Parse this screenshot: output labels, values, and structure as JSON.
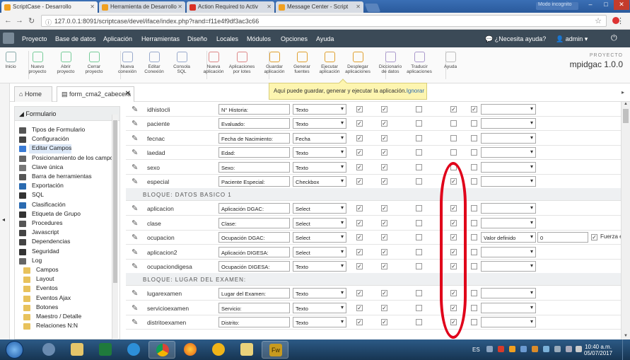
{
  "browser": {
    "tabs": [
      {
        "title": "ScriptCase - Desarrollo",
        "color": "#f0a020"
      },
      {
        "title": "Herramienta de Desarrollo",
        "color": "#f0a020"
      },
      {
        "title": "Action Required to Activ",
        "color": "#d93025"
      },
      {
        "title": "Message Center - Script",
        "color": "#f0a020"
      }
    ],
    "url": "127.0.0.1:8091/scriptcase/devel/iface/index.php?rand=f11e4f9df3ac3c66",
    "user_chip": "Modo incognito"
  },
  "menu": {
    "items": [
      "Proyecto",
      "Base de datos",
      "Aplicación",
      "Herramientas",
      "Diseño",
      "Locales",
      "Módulos",
      "Opciones",
      "Ayuda"
    ],
    "help": "¿Necesita ayuda?",
    "user": "admin"
  },
  "toolbar": {
    "buttons": [
      [
        "Inicio",
        ""
      ],
      [
        "Nuevo",
        "proyecto"
      ],
      [
        "Abrir",
        "proyecto"
      ],
      [
        "Cerrar",
        "proyecto"
      ],
      [
        "Nueva",
        "conexión"
      ],
      [
        "Editar",
        "Conexión"
      ],
      [
        "Consola",
        "SQL"
      ],
      [
        "Nueva",
        "aplicación"
      ],
      [
        "Aplicaciones",
        "por lotes"
      ],
      [
        "Guardar",
        "aplicación"
      ],
      [
        "Generar",
        "fuentes"
      ],
      [
        "Ejecutar",
        "aplicación"
      ],
      [
        "Desplegar",
        "aplicaciones"
      ],
      [
        "Diccionario",
        "de datos"
      ],
      [
        "Traducir",
        "aplicaciones"
      ],
      [
        "Ayuda",
        ""
      ]
    ],
    "project_label": "PROYECTO",
    "project_name": "mpidgac 1.0.0"
  },
  "doctabs": {
    "home": "Home",
    "form": "form_cma2_cabecera"
  },
  "tooltip": {
    "text": "Aquí puede guardar, generar y ejecutar la aplicación.",
    "ignore": "Ignorar"
  },
  "sidebar": {
    "title": "Formulario",
    "items": [
      {
        "label": "Tipos de Formulario",
        "icon": "#555"
      },
      {
        "label": "Configuración",
        "icon": "#444"
      },
      {
        "label": "Editar Campos",
        "icon": "#3a7bd5",
        "selected": true
      },
      {
        "label": "Posicionamiento de los campos",
        "icon": "#666"
      },
      {
        "label": "Clave única",
        "icon": "#777"
      },
      {
        "label": "Barra de herramientas",
        "icon": "#555"
      },
      {
        "label": "Exportación",
        "icon": "#2a6ab0"
      },
      {
        "label": "SQL",
        "icon": "#333"
      },
      {
        "label": "Clasificación",
        "icon": "#2a6ab0"
      },
      {
        "label": "Etiqueta de Grupo",
        "icon": "#333"
      },
      {
        "label": "Procedures",
        "icon": "#555"
      },
      {
        "label": "Javascript",
        "icon": "#444"
      },
      {
        "label": "Dependencias",
        "icon": "#444"
      },
      {
        "label": "Seguridad",
        "icon": "#333"
      },
      {
        "label": "Log",
        "icon": "#666"
      },
      {
        "label": "Campos",
        "icon": "folder"
      },
      {
        "label": "Layout",
        "icon": "folder"
      },
      {
        "label": "Eventos",
        "icon": "folder"
      },
      {
        "label": "Eventos Ajax",
        "icon": "folder"
      },
      {
        "label": "Botones",
        "icon": "folder"
      },
      {
        "label": "Maestro / Detalle",
        "icon": "folder"
      },
      {
        "label": "Relaciones N:N",
        "icon": "folder"
      }
    ]
  },
  "grid": [
    {
      "kind": "row",
      "name": "idhistocli",
      "label": "N° Historia:",
      "type": "Texto",
      "c": [
        1,
        1,
        0,
        1,
        1
      ]
    },
    {
      "kind": "row",
      "name": "paciente",
      "label": "Evaluado:",
      "type": "Texto",
      "c": [
        1,
        1,
        0,
        0,
        0
      ]
    },
    {
      "kind": "row",
      "name": "fecnac",
      "label": "Fecha de Nacimiento:",
      "type": "Fecha",
      "c": [
        1,
        1,
        0,
        0,
        0
      ]
    },
    {
      "kind": "row",
      "name": "laedad",
      "label": "Edad:",
      "type": "Texto",
      "c": [
        1,
        1,
        0,
        0,
        0
      ]
    },
    {
      "kind": "row",
      "name": "sexo",
      "label": "Sexo:",
      "type": "Texto",
      "c": [
        1,
        1,
        0,
        0,
        0
      ]
    },
    {
      "kind": "row",
      "name": "especial",
      "label": "Paciente Especial:",
      "type": "Checkbox",
      "c": [
        1,
        1,
        0,
        1,
        0
      ]
    },
    {
      "kind": "section",
      "title": "BLOQUE: DATOS BASICO 1"
    },
    {
      "kind": "row",
      "name": "aplicacion",
      "label": "Aplicación DGAC:",
      "type": "Select",
      "c": [
        1,
        1,
        0,
        1,
        0
      ]
    },
    {
      "kind": "row",
      "name": "clase",
      "label": "Clase:",
      "type": "Select",
      "c": [
        1,
        1,
        0,
        1,
        0
      ]
    },
    {
      "kind": "row",
      "name": "ocupacion",
      "label": "Ocupación DGAC:",
      "type": "Select",
      "c": [
        1,
        1,
        0,
        1,
        0
      ],
      "dd": "Valor definido",
      "num": "0",
      "extra": "Fuerza e"
    },
    {
      "kind": "row",
      "name": "aplicacion2",
      "label": "Aplicación DIGESA:",
      "type": "Select",
      "c": [
        1,
        1,
        0,
        1,
        0
      ]
    },
    {
      "kind": "row",
      "name": "ocupaciondigesa",
      "label": "Ocupación DIGESA:",
      "type": "Texto",
      "c": [
        1,
        1,
        0,
        1,
        0
      ]
    },
    {
      "kind": "section",
      "title": "BLOQUE: LUGAR DEL EXAMEN:"
    },
    {
      "kind": "row",
      "name": "lugarexamen",
      "label": "Lugar del Examen:",
      "type": "Texto",
      "c": [
        1,
        1,
        0,
        1,
        0
      ]
    },
    {
      "kind": "row",
      "name": "servicioexamen",
      "label": "Servicio:",
      "type": "Texto",
      "c": [
        1,
        1,
        0,
        1,
        0
      ]
    },
    {
      "kind": "row",
      "name": "distritoexamen",
      "label": "Distrito:",
      "type": "Texto",
      "c": [
        1,
        1,
        0,
        1,
        0
      ]
    }
  ],
  "taskbar": {
    "lang": "ES",
    "time": "10:40 a.m.",
    "date": "05/07/2017"
  }
}
